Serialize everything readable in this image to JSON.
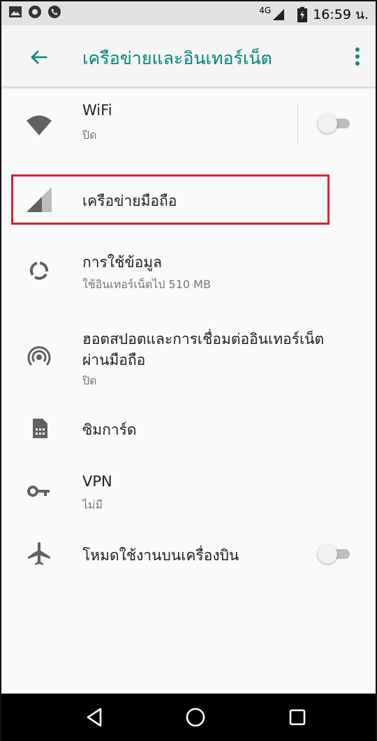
{
  "status_bar": {
    "network": "4G",
    "time": "16:59 น."
  },
  "app_bar": {
    "title": "เครือข่ายและอินเทอร์เน็ต"
  },
  "settings": [
    {
      "title": "WiFi",
      "subtitle": "ปิด",
      "icon": "wifi-icon",
      "toggle_on": false
    },
    {
      "title": "เครือข่ายมือถือ",
      "icon": "cellular-signal-icon"
    },
    {
      "title": "การใช้ข้อมูล",
      "subtitle": "ใช้อินเทอร์เน็ตไป 510 MB",
      "icon": "data-usage-icon"
    },
    {
      "title_line1": "ฮอตสปอตและการเชื่อมต่ออินเทอร์เน็ต",
      "title_line2": "ผ่านมือถือ",
      "subtitle": "ปิด",
      "icon": "hotspot-icon"
    },
    {
      "title": "ซิมการ์ด",
      "icon": "sim-card-icon"
    },
    {
      "title": "VPN",
      "subtitle": "ไม่มี",
      "icon": "vpn-key-icon"
    },
    {
      "title": "โหมดใช้งานบนเครื่องบิน",
      "icon": "airplane-icon",
      "toggle_on": false
    }
  ],
  "colors": {
    "accent": "#00897b",
    "highlight_box": "#e0202a",
    "background": "#fafafa"
  }
}
